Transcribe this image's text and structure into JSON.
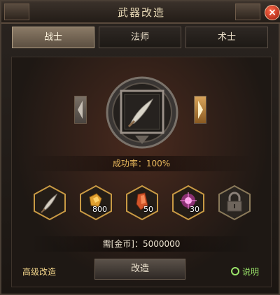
{
  "window": {
    "title": "武器改造",
    "close_label": "×"
  },
  "tabs": [
    {
      "label": "战士",
      "active": true
    },
    {
      "label": "法师",
      "active": false
    },
    {
      "label": "术士",
      "active": false
    }
  ],
  "item": {
    "icon": "feather-blade-icon"
  },
  "success": {
    "text": "成功率：100%"
  },
  "materials": [
    {
      "icon": "feather-blade-icon",
      "count": ""
    },
    {
      "icon": "gold-ore-icon",
      "count": "800"
    },
    {
      "icon": "red-crystal-icon",
      "count": "50"
    },
    {
      "icon": "pink-gem-icon",
      "count": "30"
    },
    {
      "icon": "lock-icon",
      "count": ""
    }
  ],
  "cost": {
    "text": "需[金币]：5000000"
  },
  "footer": {
    "advanced_label": "高级改造",
    "modify_button": "改造",
    "help_label": "说明"
  },
  "colors": {
    "accent_gold": "#e8b85c",
    "help_green": "#9be46a",
    "close_red": "#c0321a"
  }
}
